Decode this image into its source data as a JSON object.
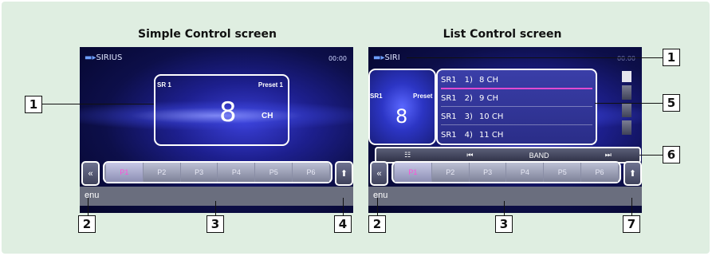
{
  "headings": {
    "simple": "Simple Control screen",
    "list": "List Control screen"
  },
  "screen": {
    "brand": "SIRIUS",
    "brand_short": "SIRI",
    "clock": "00:00",
    "band_label": "SR 1",
    "band_label_list": "SR1",
    "preset_label": "Preset 1",
    "preset_label_list": "Preset",
    "channel": "8",
    "channel_unit": "CH",
    "menu_label": "enu"
  },
  "presets": [
    "P1",
    "P2",
    "P3",
    "P4",
    "P5",
    "P6"
  ],
  "channel_list": [
    {
      "band": "SR1",
      "index": "1)",
      "channel": "8 CH"
    },
    {
      "band": "SR1",
      "index": "2)",
      "channel": "9 CH"
    },
    {
      "band": "SR1",
      "index": "3)",
      "channel": "10 CH"
    },
    {
      "band": "SR1",
      "index": "4)",
      "channel": "11 CH"
    }
  ],
  "control_bar": {
    "list_icon": "list-icon",
    "prev": "⏮",
    "band": "BAND",
    "next": "⏭"
  },
  "callouts": {
    "c1a": "1",
    "c2a": "2",
    "c3a": "3",
    "c4": "4",
    "c1b": "1",
    "c5": "5",
    "c6": "6",
    "c2b": "2",
    "c3b": "3",
    "c7": "7"
  },
  "icons": {
    "back": "chevron-double-left-icon",
    "upload": "arrow-up-icon"
  }
}
